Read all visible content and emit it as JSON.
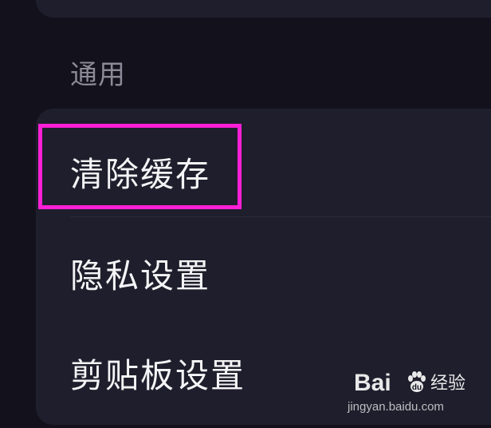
{
  "section": {
    "title": "通用"
  },
  "settings": {
    "items": [
      {
        "label": "清除缓存",
        "highlighted": true
      },
      {
        "label": "隐私设置"
      },
      {
        "label": "剪贴板设置"
      }
    ]
  },
  "annotation": {
    "highlight_color": "#ff1fd6"
  },
  "watermark": {
    "logo_text": "Bai",
    "suffix_text": "经验",
    "url": "jingyan.baidu.com"
  },
  "colors": {
    "background": "#12111c",
    "card": "#1f1e2c",
    "primary_text": "#f4f4f6",
    "secondary_text": "#8b8a96"
  }
}
